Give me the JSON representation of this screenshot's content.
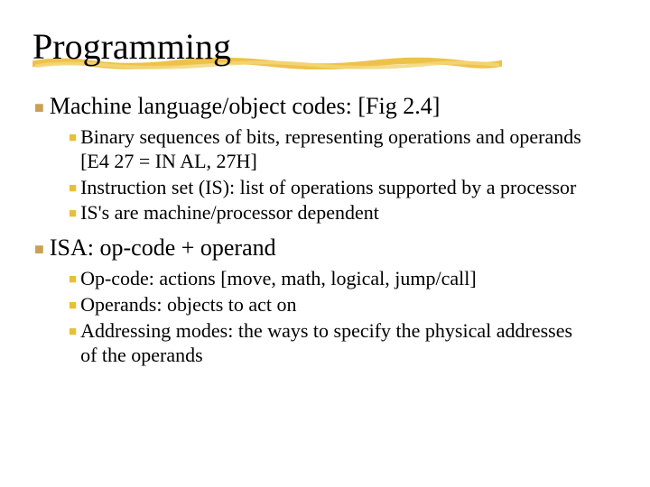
{
  "title": "Programming",
  "sections": [
    {
      "heading": "Machine language/object codes: [Fig 2.4]",
      "items": [
        "Binary sequences of bits, representing operations and operands [E4 27 = IN AL, 27H]",
        "Instruction set (IS): list of operations supported by a processor",
        "IS's are machine/processor dependent"
      ]
    },
    {
      "heading": "ISA: op-code + operand",
      "items": [
        "Op-code: actions [move, math, logical, jump/call]",
        "Operands: objects to act on",
        "Addressing modes: the ways to specify the physical addresses of the operands"
      ]
    }
  ]
}
